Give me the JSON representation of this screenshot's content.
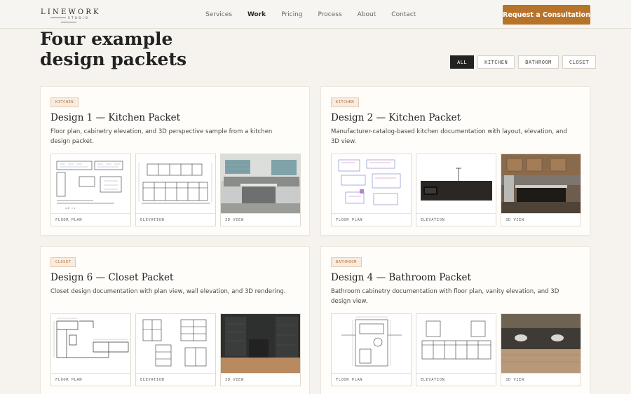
{
  "brand": {
    "name": "LINEWORK",
    "sub": "STUDIO"
  },
  "nav": {
    "items": [
      "Services",
      "Work",
      "Pricing",
      "Process",
      "About",
      "Contact"
    ],
    "active": "Work",
    "cta_label": "Request a Consultation"
  },
  "page": {
    "title": "Four example design packets"
  },
  "filters": {
    "items": [
      "ALL",
      "KITCHEN",
      "BATHROOM",
      "CLOSET"
    ],
    "active": "ALL"
  },
  "thumb_labels": {
    "floor": "FLOOR PLAN",
    "elevation": "ELEVATION",
    "view3d": "3D VIEW"
  },
  "cards": [
    {
      "tag": "KITCHEN",
      "title": "Design 1 — Kitchen Packet",
      "description": "Floor plan, cabinetry elevation, and 3D perspective sample from a kitchen design packet."
    },
    {
      "tag": "KITCHEN",
      "title": "Design 2 — Kitchen Packet",
      "description": "Manufacturer-catalog-based kitchen documentation with layout, elevation, and 3D view."
    },
    {
      "tag": "CLOSET",
      "title": "Design 6 — Closet Packet",
      "description": "Closet design documentation with plan view, wall elevation, and 3D rendering."
    },
    {
      "tag": "BATHROOM",
      "title": "Design 4 — Bathroom Packet",
      "description": "Bathroom cabinetry documentation with floor plan, vanity elevation, and 3D design view."
    }
  ],
  "colors": {
    "accent": "#b8732b",
    "background": "#f6f3ee",
    "tag_text": "#b6743a"
  }
}
